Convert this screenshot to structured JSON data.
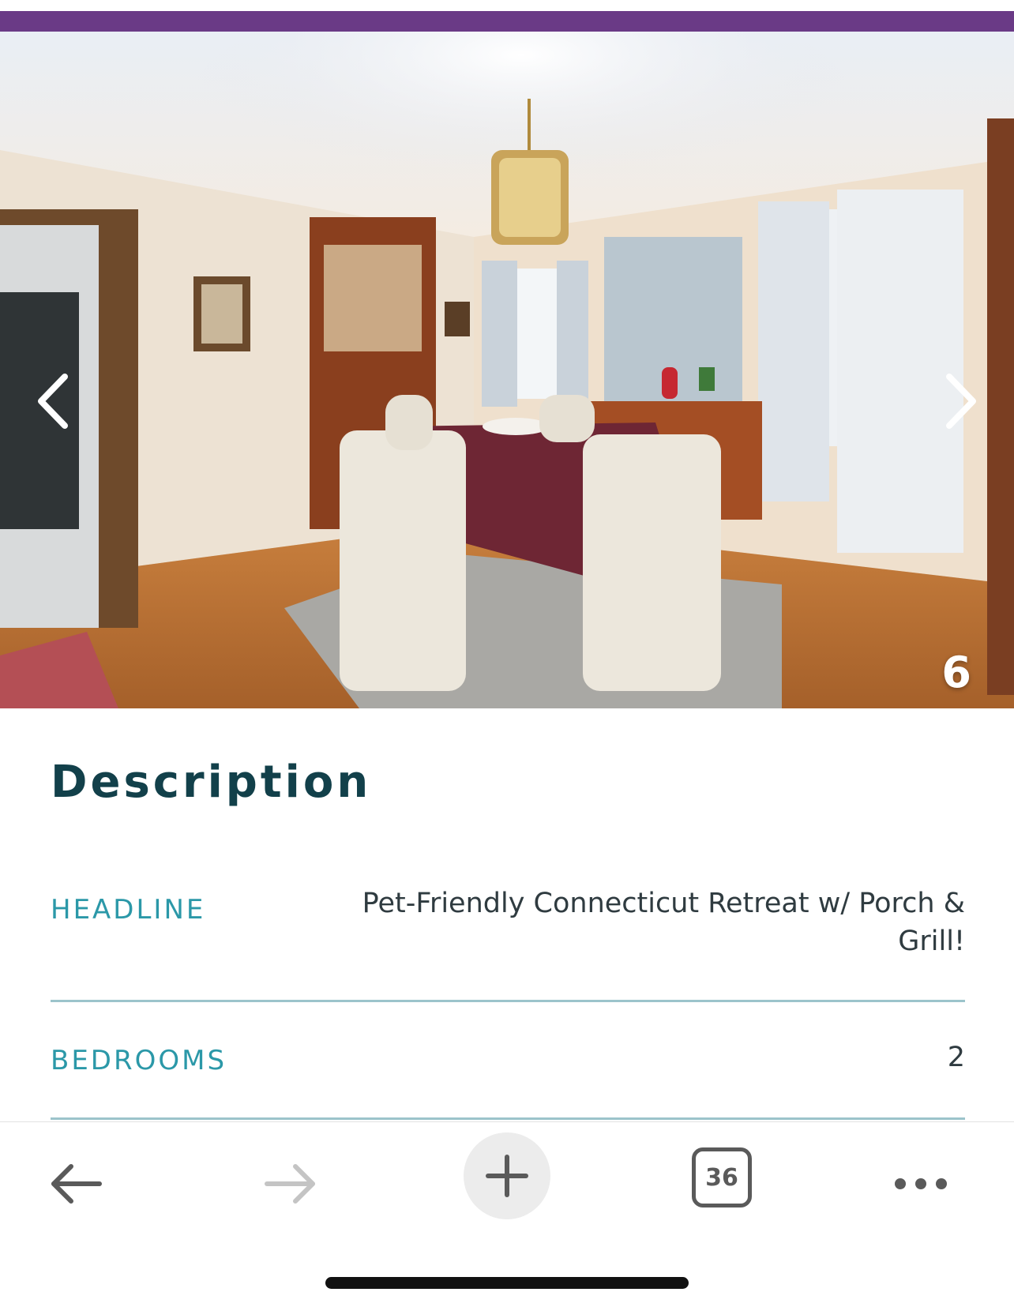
{
  "carousel": {
    "photo_alt": "Dining room with chandelier, table and chairs",
    "counter": "6",
    "prev_icon": "chevron-left-icon",
    "next_icon": "chevron-right-icon"
  },
  "description": {
    "title": "Description",
    "rows": [
      {
        "label": "HEADLINE",
        "value": "Pet-Friendly Connecticut Retreat w/ Porch & Grill!"
      },
      {
        "label": "BEDROOMS",
        "value": "2"
      }
    ]
  },
  "toolbar": {
    "back_icon": "arrow-left-icon",
    "forward_icon": "arrow-right-icon",
    "new_tab_icon": "plus-icon",
    "tab_count": "36",
    "more_icon": "more-horizontal-icon"
  },
  "colors": {
    "brand_stripe": "#6a3a86",
    "title": "#12404a",
    "label": "#2b98a8",
    "divider": "#9cc4cb"
  }
}
